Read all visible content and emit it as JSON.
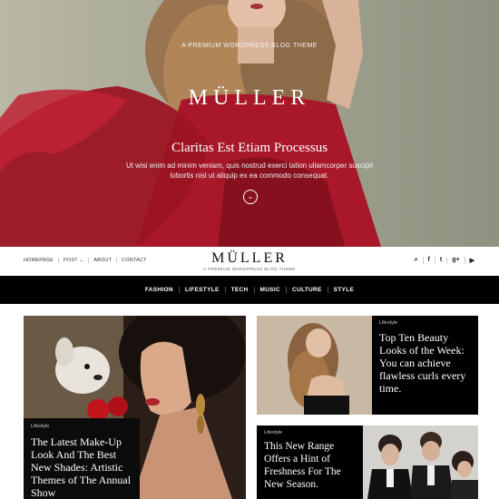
{
  "hero": {
    "tagline": "A PREMIUM WORDPRESS BLOG THEME",
    "logo": "MÜLLER",
    "title": "Claritas Est Etiam Processus",
    "subtitle_line1": "Ut wisi enim ad minim veniam, quis nostrud exerci tation ullamcorper suscipit",
    "subtitle_line2": "lobortis nisl ut aliquip ex ea commodo consequat.",
    "down_icon": "chevron-down-icon"
  },
  "header": {
    "logo": "MÜLLER",
    "tagline": "A PREMIUM WORDPRESS BLOG THEME",
    "menu": [
      {
        "label": "HOMEPAGE"
      },
      {
        "label": "POST ⌄"
      },
      {
        "label": "ABOUT"
      },
      {
        "label": "CONTACT"
      }
    ],
    "social": [
      {
        "label": "⌕",
        "icon": "search-icon"
      },
      {
        "label": "f",
        "icon": "facebook-icon"
      },
      {
        "label": "t",
        "icon": "twitter-icon"
      },
      {
        "label": "g+",
        "icon": "google-plus-icon"
      },
      {
        "label": "▶",
        "icon": "youtube-icon"
      }
    ]
  },
  "categories": [
    {
      "label": "FASHION"
    },
    {
      "label": "LIFESTYLE"
    },
    {
      "label": "TECH"
    },
    {
      "label": "MUSIC"
    },
    {
      "label": "CULTURE"
    },
    {
      "label": "STYLE"
    }
  ],
  "posts": [
    {
      "category": "Lifestyle",
      "title": "The Latest Make-Up Look And The Best New Shades: Artistic Themes of The Annual Show"
    },
    {
      "category": "Lifestyle",
      "title": "Top Ten Beauty Looks of the Week: You can achieve flawless curls every time."
    },
    {
      "category": "Lifestyle",
      "title": "This New Range Offers a Hint of Freshness For The New Season."
    }
  ],
  "colors": {
    "accent": "#000000",
    "hero_dress": "#a01822"
  }
}
